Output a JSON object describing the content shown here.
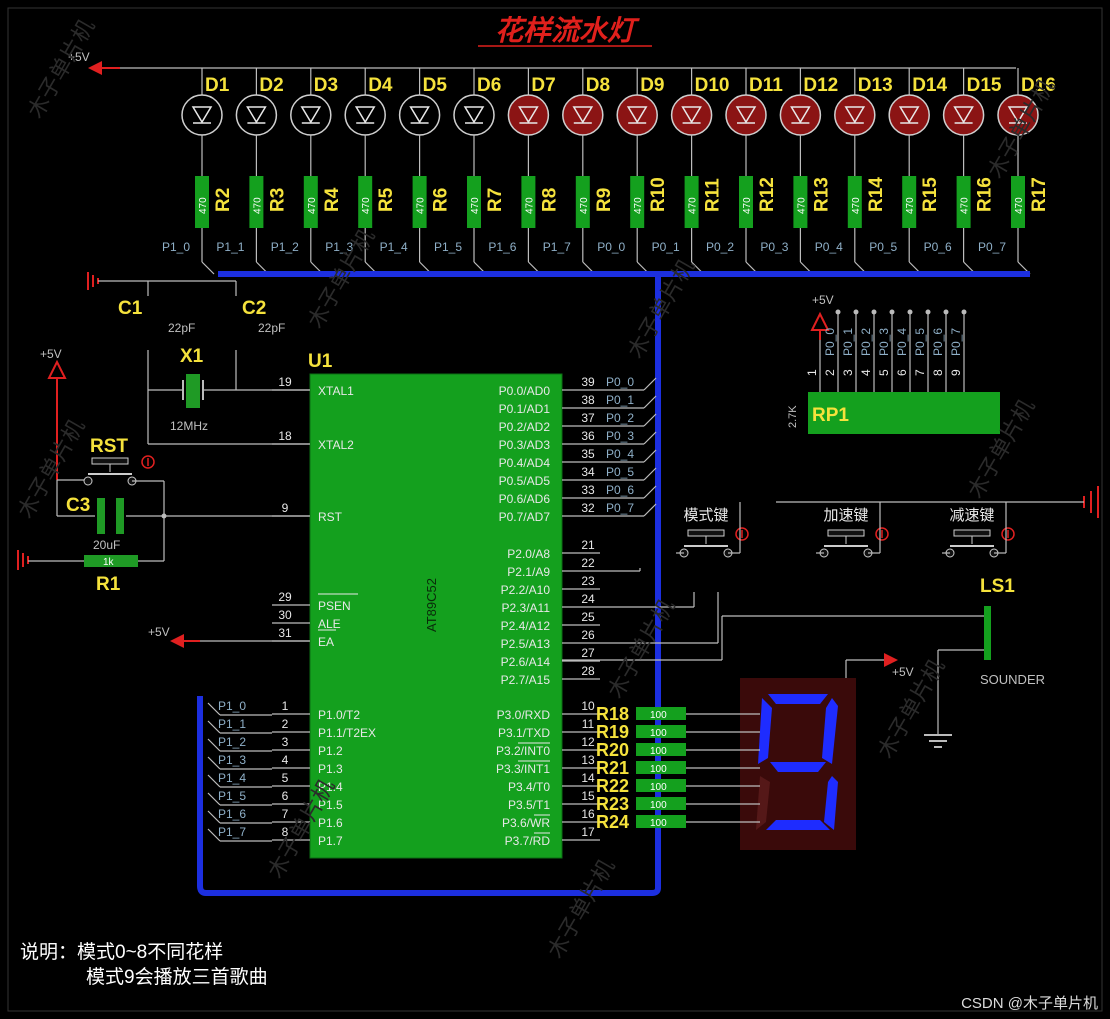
{
  "title": "花样流水灯",
  "power_label": "+5V",
  "leds": [
    "D1",
    "D2",
    "D3",
    "D4",
    "D5",
    "D6",
    "D7",
    "D8",
    "D9",
    "D10",
    "D11",
    "D12",
    "D13",
    "D14",
    "D15",
    "D16"
  ],
  "led_on": [
    false,
    false,
    false,
    false,
    false,
    false,
    true,
    true,
    true,
    true,
    true,
    true,
    true,
    true,
    true,
    true
  ],
  "led_resistors": {
    "names": [
      "R2",
      "R3",
      "R4",
      "R5",
      "R6",
      "R7",
      "R8",
      "R9",
      "R10",
      "R11",
      "R12",
      "R13",
      "R14",
      "R15",
      "R16",
      "R17"
    ],
    "value": "470",
    "nets": [
      "P1_0",
      "P1_1",
      "P1_2",
      "P1_3",
      "P1_4",
      "P1_5",
      "P1_6",
      "P1_7",
      "P0_0",
      "P0_1",
      "P0_2",
      "P0_3",
      "P0_4",
      "P0_5",
      "P0_6",
      "P0_7"
    ]
  },
  "caps": {
    "c1": "C1",
    "c2": "C2",
    "c1_value": "22pF",
    "c2_value": "22pF",
    "c3": "C3",
    "c3_value": "20uF"
  },
  "crystal": {
    "name": "X1",
    "value": "12MHz"
  },
  "reset": {
    "button": "RST",
    "resistor": "R1",
    "resistor_value": "1k"
  },
  "mcu": {
    "ref": "U1",
    "part": "AT89C52",
    "left_pins": [
      {
        "num": "19",
        "name": "XTAL1"
      },
      {
        "num": "18",
        "name": "XTAL2"
      },
      {
        "num": "9",
        "name": "RST"
      },
      {
        "num": "29",
        "name": "PSEN"
      },
      {
        "num": "30",
        "name": "ALE"
      },
      {
        "num": "31",
        "name": "EA"
      },
      {
        "num": "1",
        "name": "P1.0/T2"
      },
      {
        "num": "2",
        "name": "P1.1/T2EX"
      },
      {
        "num": "3",
        "name": "P1.2"
      },
      {
        "num": "4",
        "name": "P1.3"
      },
      {
        "num": "5",
        "name": "P1.4"
      },
      {
        "num": "6",
        "name": "P1.5"
      },
      {
        "num": "7",
        "name": "P1.6"
      },
      {
        "num": "8",
        "name": "P1.7"
      }
    ],
    "p0_pins": [
      {
        "num": "39",
        "name": "P0.0/AD0",
        "net": "P0_0"
      },
      {
        "num": "38",
        "name": "P0.1/AD1",
        "net": "P0_1"
      },
      {
        "num": "37",
        "name": "P0.2/AD2",
        "net": "P0_2"
      },
      {
        "num": "36",
        "name": "P0.3/AD3",
        "net": "P0_3"
      },
      {
        "num": "35",
        "name": "P0.4/AD4",
        "net": "P0_4"
      },
      {
        "num": "34",
        "name": "P0.5/AD5",
        "net": "P0_5"
      },
      {
        "num": "33",
        "name": "P0.6/AD6",
        "net": "P0_6"
      },
      {
        "num": "32",
        "name": "P0.7/AD7",
        "net": "P0_7"
      }
    ],
    "p2_pins": [
      {
        "num": "21",
        "name": "P2.0/A8"
      },
      {
        "num": "22",
        "name": "P2.1/A9"
      },
      {
        "num": "23",
        "name": "P2.2/A10"
      },
      {
        "num": "24",
        "name": "P2.3/A11"
      },
      {
        "num": "25",
        "name": "P2.4/A12"
      },
      {
        "num": "26",
        "name": "P2.5/A13"
      },
      {
        "num": "27",
        "name": "P2.6/A14"
      },
      {
        "num": "28",
        "name": "P2.7/A15"
      }
    ],
    "p3_pins": [
      {
        "num": "10",
        "name": "P3.0/RXD"
      },
      {
        "num": "11",
        "name": "P3.1/TXD"
      },
      {
        "num": "12",
        "name": "P3.2/INT0"
      },
      {
        "num": "13",
        "name": "P3.3/INT1"
      },
      {
        "num": "14",
        "name": "P3.4/T0"
      },
      {
        "num": "15",
        "name": "P3.5/T1"
      },
      {
        "num": "16",
        "name": "P3.6/WR"
      },
      {
        "num": "17",
        "name": "P3.7/RD"
      }
    ]
  },
  "p1_bus_labels": [
    "P1_0",
    "P1_1",
    "P1_2",
    "P1_3",
    "P1_4",
    "P1_5",
    "P1_6",
    "P1_7"
  ],
  "rpack": {
    "name": "RP1",
    "value": "2.7K",
    "pins": [
      "1",
      "2",
      "3",
      "4",
      "5",
      "6",
      "7",
      "8",
      "9"
    ],
    "nets": [
      "P0_0",
      "P0_1",
      "P0_2",
      "P0_3",
      "P0_4",
      "P0_5",
      "P0_6",
      "P0_7"
    ]
  },
  "keys": [
    "模式键",
    "加速键",
    "减速键"
  ],
  "seg_resistors": {
    "names": [
      "R18",
      "R19",
      "R20",
      "R21",
      "R22",
      "R23",
      "R24"
    ],
    "value": "100"
  },
  "display_digit": "9",
  "sounder": {
    "name": "LS1",
    "label": "SOUNDER"
  },
  "note": {
    "line1": "说明：模式0~8不同花样",
    "line2": "模式9会播放三首歌曲"
  },
  "watermark": "CSDN @木子单片机",
  "colors": {
    "background": "#000000",
    "part_body": "#14a01e",
    "led_on": "#8b1414",
    "bus": "#1c2fe0",
    "title": "#e0201c",
    "labels": "#f5e23c",
    "segment": "#1e2cff",
    "display_body": "#3a0a0a"
  }
}
